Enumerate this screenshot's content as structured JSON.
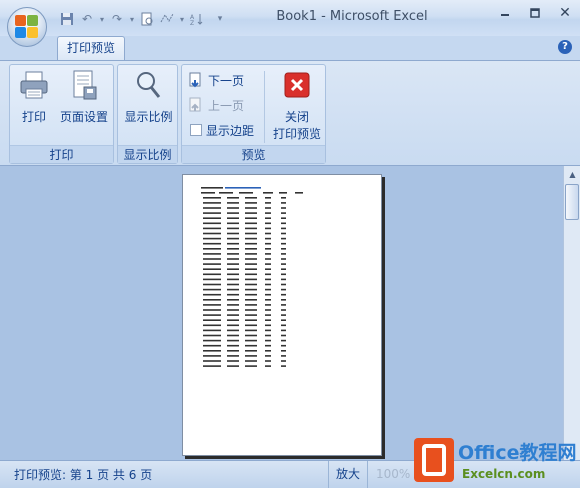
{
  "window": {
    "title": "Book1 - Microsoft Excel"
  },
  "qat": {
    "icons": [
      "save-icon",
      "undo-icon",
      "redo-icon",
      "print-preview-icon",
      "scatter-icon",
      "sort-icon"
    ]
  },
  "tabs": {
    "active": "打印预览"
  },
  "ribbon": {
    "groups": [
      {
        "label": "打印",
        "buttons": [
          "打印",
          "页面设置"
        ]
      },
      {
        "label": "显示比例",
        "buttons": [
          "显示比例"
        ]
      },
      {
        "label": "预览",
        "next_page": "下一页",
        "prev_page": "上一页",
        "show_margins": "显示边距",
        "close": "关闭",
        "close_line2": "打印预览"
      }
    ]
  },
  "status": {
    "left": "打印预览: 第 1 页  共 6 页",
    "zoom_label": "放大",
    "zoom_value": "100%"
  },
  "watermark": {
    "title": "Office教程网",
    "url": "Excelcn.com"
  }
}
